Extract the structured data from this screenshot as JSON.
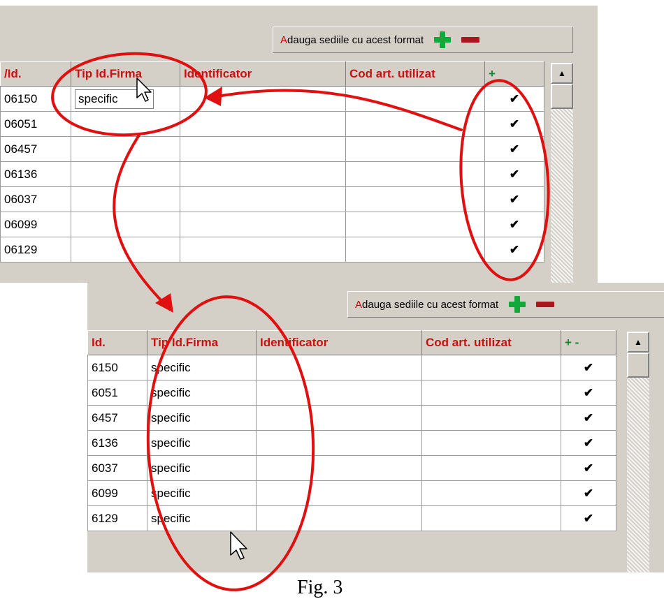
{
  "top_panel": {
    "toolbar": {
      "first_letter": "A",
      "label_rest": "dauga sediile cu acest format",
      "add_icon": "green-plus-icon",
      "remove_icon": "red-minus-icon"
    },
    "columns": [
      "/Id.",
      "Tip Id.Firma",
      "Identificator",
      "Cod art. utilizat",
      "+"
    ],
    "rows": [
      {
        "id": "06150",
        "tip": "specific"
      },
      {
        "id": "06051",
        "tip": ""
      },
      {
        "id": "06457",
        "tip": ""
      },
      {
        "id": "06136",
        "tip": ""
      },
      {
        "id": "06037",
        "tip": ""
      },
      {
        "id": "06099",
        "tip": ""
      },
      {
        "id": "06129",
        "tip": ""
      }
    ]
  },
  "bottom_panel": {
    "toolbar": {
      "first_letter": "A",
      "label_rest": "dauga sediile cu acest format",
      "add_icon": "green-plus-icon",
      "remove_icon": "red-minus-icon"
    },
    "columns": [
      "Id.",
      "Tip Id.Firma",
      "Identificator",
      "Cod art. utilizat",
      "+  -"
    ],
    "rows": [
      {
        "id": "6150",
        "tip": "specific"
      },
      {
        "id": "6051",
        "tip": "specific"
      },
      {
        "id": "6457",
        "tip": "specific"
      },
      {
        "id": "6136",
        "tip": "specific"
      },
      {
        "id": "6037",
        "tip": "specific"
      },
      {
        "id": "6099",
        "tip": "specific"
      },
      {
        "id": "6129",
        "tip": "specific"
      }
    ]
  },
  "check_mark": "✔",
  "caption": "Fig. 3",
  "colors": {
    "header_text": "#cc1010",
    "annotation": "#e01010",
    "plus": "#14a83b",
    "minus": "#a8161e"
  }
}
